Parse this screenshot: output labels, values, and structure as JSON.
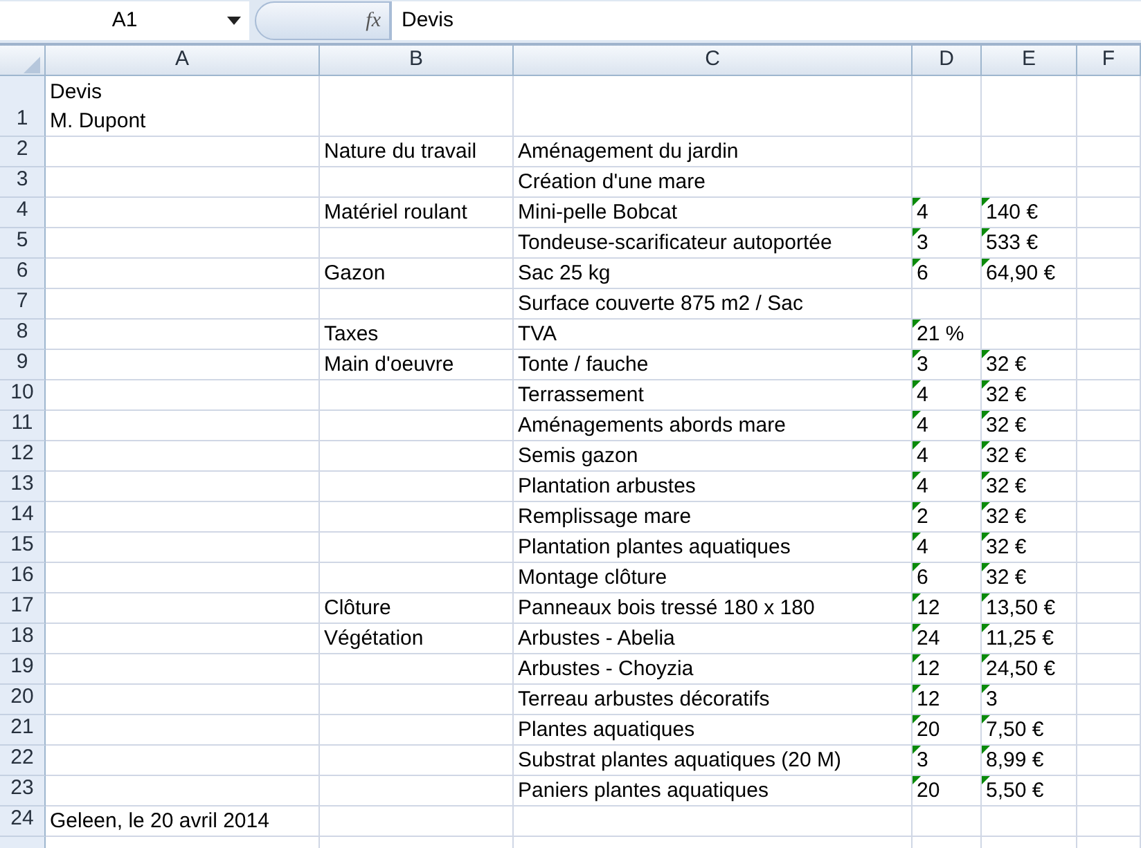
{
  "name_box": "A1",
  "function_label": "fx",
  "formula_bar": "Devis",
  "columns": [
    "A",
    "B",
    "C",
    "D",
    "E",
    "F"
  ],
  "rows": [
    {
      "row": "1",
      "cells": {
        "A": {
          "text": "Devis\nM. Dupont"
        }
      }
    },
    {
      "row": "2",
      "cells": {
        "B": {
          "text": "Nature du travail"
        },
        "C": {
          "text": "Aménagement du jardin"
        }
      }
    },
    {
      "row": "3",
      "cells": {
        "C": {
          "text": "Création d'une mare"
        }
      }
    },
    {
      "row": "4",
      "cells": {
        "B": {
          "text": "Matériel roulant"
        },
        "C": {
          "text": "Mini-pelle Bobcat"
        },
        "D": {
          "text": "4",
          "flag": true
        },
        "E": {
          "text": "140 €",
          "flag": true
        }
      }
    },
    {
      "row": "5",
      "cells": {
        "C": {
          "text": "Tondeuse-scarificateur autoportée"
        },
        "D": {
          "text": "3",
          "flag": true
        },
        "E": {
          "text": "533 €",
          "flag": true
        }
      }
    },
    {
      "row": "6",
      "cells": {
        "B": {
          "text": "Gazon"
        },
        "C": {
          "text": "Sac 25 kg"
        },
        "D": {
          "text": "6",
          "flag": true
        },
        "E": {
          "text": "64,90 €",
          "flag": true
        }
      }
    },
    {
      "row": "7",
      "cells": {
        "C": {
          "text": "Surface couverte 875 m2 / Sac"
        }
      }
    },
    {
      "row": "8",
      "cells": {
        "B": {
          "text": "Taxes"
        },
        "C": {
          "text": "TVA"
        },
        "D": {
          "text": "21 %",
          "flag": true
        }
      }
    },
    {
      "row": "9",
      "cells": {
        "B": {
          "text": "Main d'oeuvre"
        },
        "C": {
          "text": "Tonte / fauche"
        },
        "D": {
          "text": "3",
          "flag": true
        },
        "E": {
          "text": "32 €",
          "flag": true
        }
      }
    },
    {
      "row": "10",
      "cells": {
        "C": {
          "text": "Terrassement"
        },
        "D": {
          "text": "4",
          "flag": true
        },
        "E": {
          "text": "32 €",
          "flag": true
        }
      }
    },
    {
      "row": "11",
      "cells": {
        "C": {
          "text": "Aménagements abords mare"
        },
        "D": {
          "text": "4",
          "flag": true
        },
        "E": {
          "text": "32 €",
          "flag": true
        }
      }
    },
    {
      "row": "12",
      "cells": {
        "C": {
          "text": "Semis gazon"
        },
        "D": {
          "text": "4",
          "flag": true
        },
        "E": {
          "text": "32 €",
          "flag": true
        }
      }
    },
    {
      "row": "13",
      "cells": {
        "C": {
          "text": "Plantation arbustes"
        },
        "D": {
          "text": "4",
          "flag": true
        },
        "E": {
          "text": "32 €",
          "flag": true
        }
      }
    },
    {
      "row": "14",
      "cells": {
        "C": {
          "text": "Remplissage mare"
        },
        "D": {
          "text": "2",
          "flag": true
        },
        "E": {
          "text": "32 €",
          "flag": true
        }
      }
    },
    {
      "row": "15",
      "cells": {
        "C": {
          "text": "Plantation plantes aquatiques"
        },
        "D": {
          "text": "4",
          "flag": true
        },
        "E": {
          "text": "32 €",
          "flag": true
        }
      }
    },
    {
      "row": "16",
      "cells": {
        "C": {
          "text": "Montage clôture"
        },
        "D": {
          "text": "6",
          "flag": true
        },
        "E": {
          "text": "32 €",
          "flag": true
        }
      }
    },
    {
      "row": "17",
      "cells": {
        "B": {
          "text": "Clôture"
        },
        "C": {
          "text": "Panneaux bois tressé 180 x 180"
        },
        "D": {
          "text": "12",
          "flag": true
        },
        "E": {
          "text": "13,50 €",
          "flag": true
        }
      }
    },
    {
      "row": "18",
      "cells": {
        "B": {
          "text": "Végétation"
        },
        "C": {
          "text": "Arbustes - Abelia"
        },
        "D": {
          "text": "24",
          "flag": true
        },
        "E": {
          "text": "11,25 €",
          "flag": true
        }
      }
    },
    {
      "row": "19",
      "cells": {
        "C": {
          "text": "Arbustes - Choyzia"
        },
        "D": {
          "text": "12",
          "flag": true
        },
        "E": {
          "text": "24,50 €",
          "flag": true
        }
      }
    },
    {
      "row": "20",
      "cells": {
        "C": {
          "text": "Terreau arbustes décoratifs"
        },
        "D": {
          "text": "12",
          "flag": true
        },
        "E": {
          "text": "3",
          "flag": true
        }
      }
    },
    {
      "row": "21",
      "cells": {
        "C": {
          "text": "Plantes aquatiques"
        },
        "D": {
          "text": "20",
          "flag": true
        },
        "E": {
          "text": "7,50 €",
          "flag": true
        }
      }
    },
    {
      "row": "22",
      "cells": {
        "C": {
          "text": "Substrat plantes aquatiques (20 M)"
        },
        "D": {
          "text": "3",
          "flag": true
        },
        "E": {
          "text": "8,99 €",
          "flag": true
        }
      }
    },
    {
      "row": "23",
      "cells": {
        "C": {
          "text": "Paniers plantes aquatiques"
        },
        "D": {
          "text": "20",
          "flag": true
        },
        "E": {
          "text": "5,50 €",
          "flag": true
        }
      }
    },
    {
      "row": "24",
      "cells": {
        "A": {
          "text": "Geleen, le 20 avril 2014"
        }
      }
    }
  ]
}
